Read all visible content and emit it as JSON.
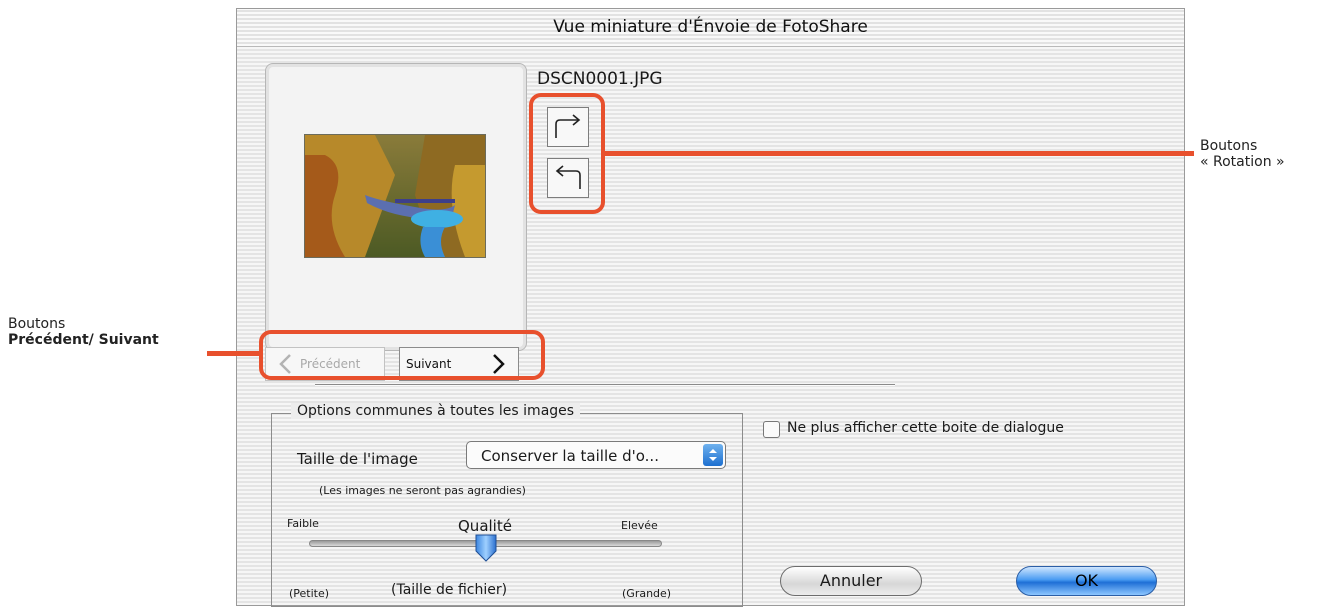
{
  "dialog": {
    "title": "Vue miniature d'Énvoie de FotoShare",
    "filename": "DSCN0001.JPG",
    "rotate_buttons": {
      "rotate_cw_icon": "arrow-turn-right-icon",
      "rotate_ccw_icon": "arrow-turn-left-icon"
    },
    "nav": {
      "prev_label": "Précédent",
      "next_label": "Suivant"
    },
    "options": {
      "group_title": "Options communes à toutes les images",
      "size_label": "Taille de l'image",
      "size_selected": "Conserver la taille d'o...",
      "size_note": "(Les images ne seront pas agrandies)",
      "quality_low": "Faible",
      "quality_label": "Qualité",
      "quality_high": "Elevée",
      "quality_value": 0.5,
      "file_small": "(Petite)",
      "file_size_label": "(Taille de fichier)",
      "file_large": "(Grande)"
    },
    "dont_show_label": "Ne plus afficher cette boite de dialogue",
    "dont_show_checked": false,
    "cancel_label": "Annuler",
    "ok_label": "OK"
  },
  "annotations": {
    "rotation_line1": "Boutons",
    "rotation_line2": "« Rotation »",
    "nav_line1": "Boutons",
    "nav_line2": "Précédent/ Suivant"
  },
  "colors": {
    "highlight": "#e8502d",
    "ok_button": "#1e6fd6"
  }
}
